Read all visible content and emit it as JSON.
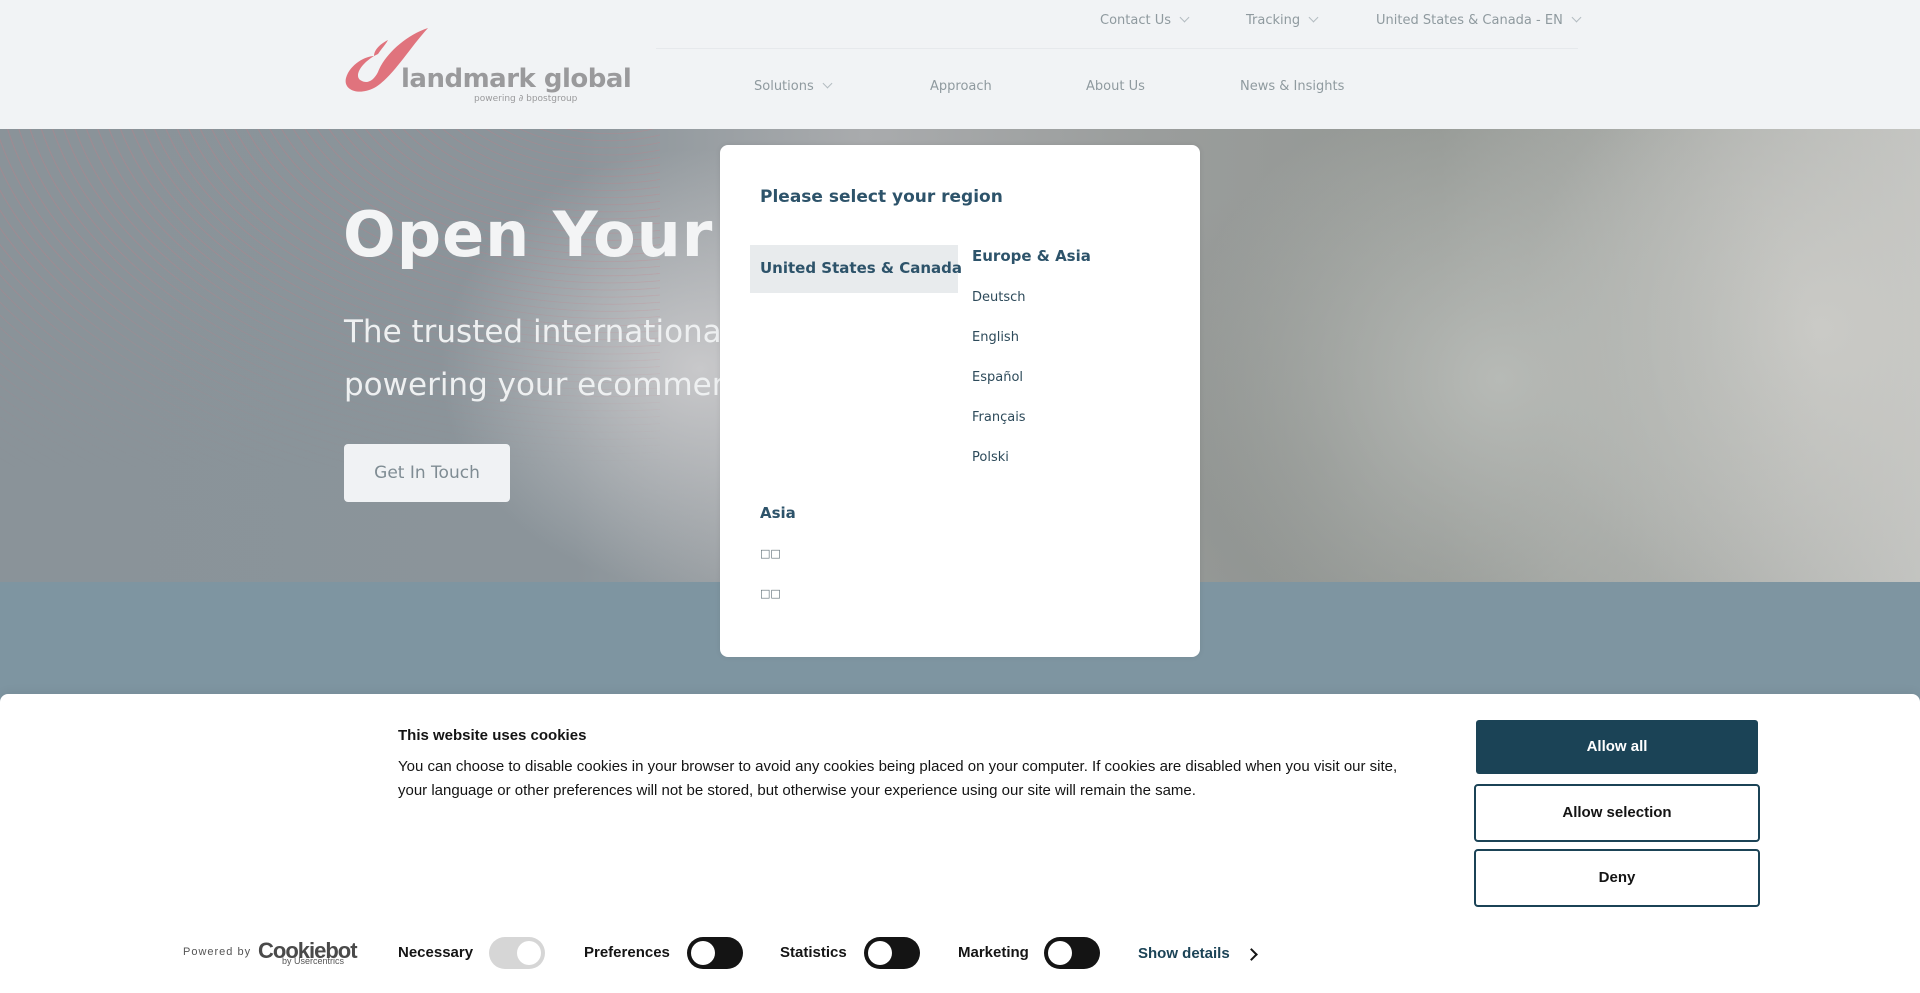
{
  "header": {
    "logo": {
      "name": "landmark global",
      "tagline": "powering ∂ bpostgroup",
      "accent": "#e0737d"
    },
    "top_nav": [
      {
        "label": "Contact Us",
        "has_dropdown": true
      },
      {
        "label": "Tracking",
        "has_dropdown": true
      },
      {
        "label": "United States & Canada - EN",
        "has_dropdown": true
      }
    ],
    "main_nav": [
      {
        "label": "Solutions",
        "has_dropdown": true
      },
      {
        "label": "Approach",
        "has_dropdown": false
      },
      {
        "label": "About Us",
        "has_dropdown": false
      },
      {
        "label": "News & Insights",
        "has_dropdown": false
      }
    ]
  },
  "hero": {
    "title": "Open Your W",
    "subtitle_line1": "The trusted international l",
    "subtitle_line2": "powering your ecommerce",
    "cta": "Get In Touch"
  },
  "region_modal": {
    "title": "Please select your region",
    "selected_region": "United States & Canada",
    "groups": [
      {
        "heading": "Europe & Asia",
        "languages": [
          "Deutsch",
          "English",
          "Español",
          "Français",
          "Polski"
        ]
      },
      {
        "heading": "Asia",
        "languages": [
          "□□",
          "□□"
        ]
      }
    ]
  },
  "cookie_banner": {
    "title": "This website uses cookies",
    "text": "You can choose to disable cookies in your browser to avoid any cookies being placed on your computer. If cookies are disabled when you visit our site, your language or other preferences will not be stored, but otherwise your experience using our site will remain the same.",
    "buttons": {
      "allow_all": "Allow all",
      "allow_selection": "Allow selection",
      "deny": "Deny"
    },
    "powered_by": "Powered by",
    "provider": "Cookiebot",
    "provider_sub": "by Usercentrics",
    "toggles": [
      {
        "label": "Necessary",
        "on": true,
        "disabled": true
      },
      {
        "label": "Preferences",
        "on": false,
        "disabled": false
      },
      {
        "label": "Statistics",
        "on": false,
        "disabled": false
      },
      {
        "label": "Marketing",
        "on": false,
        "disabled": false
      }
    ],
    "show_details": "Show details",
    "primary_color": "#1b4356"
  }
}
